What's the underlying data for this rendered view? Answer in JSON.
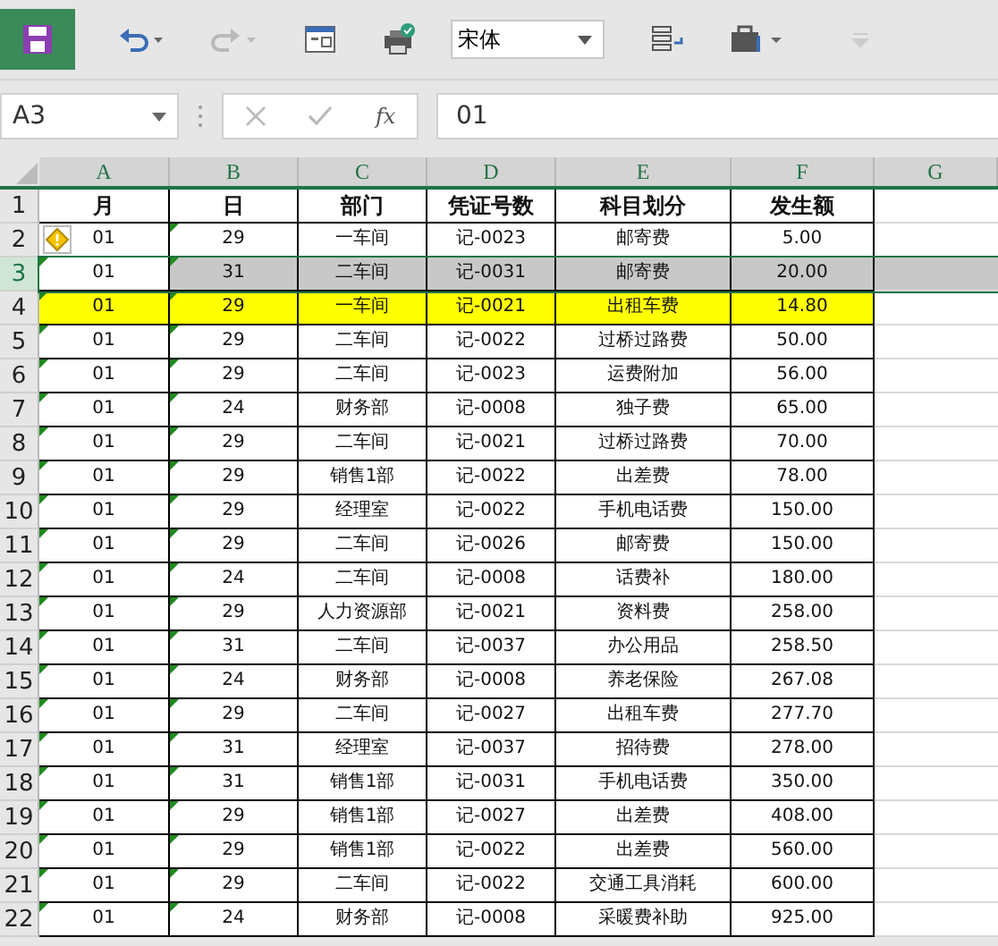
{
  "toolbar": {
    "font": "宋体",
    "redo_disabled": true
  },
  "formula_bar": {
    "name_box": "A3",
    "fx": "fx",
    "value": "01"
  },
  "columns": [
    "A",
    "B",
    "C",
    "D",
    "E",
    "F",
    "G"
  ],
  "header_row": {
    "num": "1",
    "cells": [
      "月",
      "日",
      "部门",
      "凭证号数",
      "科目划分",
      "发生额"
    ]
  },
  "rows": [
    {
      "num": "2",
      "cells": [
        "01",
        "29",
        "一车间",
        "记-0023",
        "邮寄费",
        "5.00"
      ],
      "selected": false,
      "highlighted": false,
      "warning": true,
      "flagged": true
    },
    {
      "num": "3",
      "cells": [
        "01",
        "31",
        "二车间",
        "记-0031",
        "邮寄费",
        "20.00"
      ],
      "selected": true,
      "highlighted": false,
      "warning": false,
      "flagged": true
    },
    {
      "num": "4",
      "cells": [
        "01",
        "29",
        "一车间",
        "记-0021",
        "出租车费",
        "14.80"
      ],
      "selected": false,
      "highlighted": true,
      "warning": false,
      "flagged": true
    },
    {
      "num": "5",
      "cells": [
        "01",
        "29",
        "二车间",
        "记-0022",
        "过桥过路费",
        "50.00"
      ],
      "selected": false,
      "highlighted": false,
      "warning": false,
      "flagged": true
    },
    {
      "num": "6",
      "cells": [
        "01",
        "29",
        "二车间",
        "记-0023",
        "运费附加",
        "56.00"
      ],
      "selected": false,
      "highlighted": false,
      "warning": false,
      "flagged": true
    },
    {
      "num": "7",
      "cells": [
        "01",
        "24",
        "财务部",
        "记-0008",
        "独子费",
        "65.00"
      ],
      "selected": false,
      "highlighted": false,
      "warning": false,
      "flagged": true
    },
    {
      "num": "8",
      "cells": [
        "01",
        "29",
        "二车间",
        "记-0021",
        "过桥过路费",
        "70.00"
      ],
      "selected": false,
      "highlighted": false,
      "warning": false,
      "flagged": true
    },
    {
      "num": "9",
      "cells": [
        "01",
        "29",
        "销售1部",
        "记-0022",
        "出差费",
        "78.00"
      ],
      "selected": false,
      "highlighted": false,
      "warning": false,
      "flagged": true
    },
    {
      "num": "10",
      "cells": [
        "01",
        "29",
        "经理室",
        "记-0022",
        "手机电话费",
        "150.00"
      ],
      "selected": false,
      "highlighted": false,
      "warning": false,
      "flagged": true
    },
    {
      "num": "11",
      "cells": [
        "01",
        "29",
        "二车间",
        "记-0026",
        "邮寄费",
        "150.00"
      ],
      "selected": false,
      "highlighted": false,
      "warning": false,
      "flagged": true
    },
    {
      "num": "12",
      "cells": [
        "01",
        "24",
        "二车间",
        "记-0008",
        "话费补",
        "180.00"
      ],
      "selected": false,
      "highlighted": false,
      "warning": false,
      "flagged": true
    },
    {
      "num": "13",
      "cells": [
        "01",
        "29",
        "人力资源部",
        "记-0021",
        "资料费",
        "258.00"
      ],
      "selected": false,
      "highlighted": false,
      "warning": false,
      "flagged": true
    },
    {
      "num": "14",
      "cells": [
        "01",
        "31",
        "二车间",
        "记-0037",
        "办公用品",
        "258.50"
      ],
      "selected": false,
      "highlighted": false,
      "warning": false,
      "flagged": true
    },
    {
      "num": "15",
      "cells": [
        "01",
        "24",
        "财务部",
        "记-0008",
        "养老保险",
        "267.08"
      ],
      "selected": false,
      "highlighted": false,
      "warning": false,
      "flagged": true
    },
    {
      "num": "16",
      "cells": [
        "01",
        "29",
        "二车间",
        "记-0027",
        "出租车费",
        "277.70"
      ],
      "selected": false,
      "highlighted": false,
      "warning": false,
      "flagged": true
    },
    {
      "num": "17",
      "cells": [
        "01",
        "31",
        "经理室",
        "记-0037",
        "招待费",
        "278.00"
      ],
      "selected": false,
      "highlighted": false,
      "warning": false,
      "flagged": true
    },
    {
      "num": "18",
      "cells": [
        "01",
        "31",
        "销售1部",
        "记-0031",
        "手机电话费",
        "350.00"
      ],
      "selected": false,
      "highlighted": false,
      "warning": false,
      "flagged": true
    },
    {
      "num": "19",
      "cells": [
        "01",
        "29",
        "销售1部",
        "记-0027",
        "出差费",
        "408.00"
      ],
      "selected": false,
      "highlighted": false,
      "warning": false,
      "flagged": true
    },
    {
      "num": "20",
      "cells": [
        "01",
        "29",
        "销售1部",
        "记-0022",
        "出差费",
        "560.00"
      ],
      "selected": false,
      "highlighted": false,
      "warning": false,
      "flagged": true
    },
    {
      "num": "21",
      "cells": [
        "01",
        "29",
        "二车间",
        "记-0022",
        "交通工具消耗",
        "600.00"
      ],
      "selected": false,
      "highlighted": false,
      "warning": false,
      "flagged": true
    },
    {
      "num": "22",
      "cells": [
        "01",
        "24",
        "财务部",
        "记-0008",
        "采暖费补助",
        "925.00"
      ],
      "selected": false,
      "highlighted": false,
      "warning": false,
      "flagged": true
    }
  ]
}
